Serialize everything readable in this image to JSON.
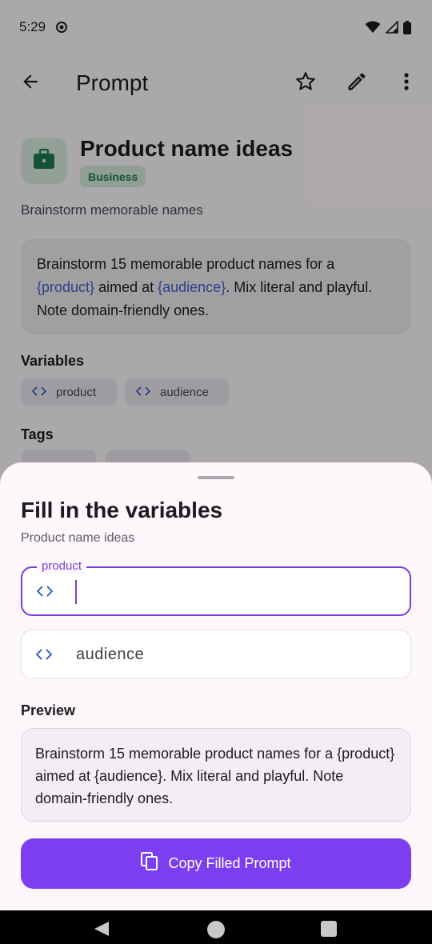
{
  "status_bar": {
    "time": "5:29",
    "icons": [
      "data-saver-icon",
      "wifi-icon",
      "signal-icon",
      "battery-icon"
    ]
  },
  "app_bar": {
    "title": "Prompt",
    "icons": [
      "back-arrow-icon",
      "star-outline-icon",
      "edit-pencil-icon",
      "more-vert-icon"
    ]
  },
  "prompt": {
    "title": "Product name ideas",
    "category": "Business",
    "category_icon": "briefcase-icon",
    "description": "Brainstorm memorable names",
    "template_parts": [
      {
        "text": "Brainstorm 15 memorable product names for a ",
        "var": false
      },
      {
        "text": "{product}",
        "var": true
      },
      {
        "text": " aimed at ",
        "var": false
      },
      {
        "text": "{audience}",
        "var": true
      },
      {
        "text": ". Mix literal and playful. Note domain-friendly ones.",
        "var": false
      }
    ]
  },
  "sections": {
    "variables": "Variables",
    "tags": "Tags"
  },
  "variable_chips": [
    "product",
    "audience"
  ],
  "sheet": {
    "title": "Fill in the variables",
    "subtitle": "Product name ideas",
    "fields": [
      {
        "label": "product",
        "value": "",
        "placeholder": "",
        "focused": true
      },
      {
        "label": "",
        "value": "",
        "placeholder": "audience",
        "focused": false
      }
    ],
    "preview_label": "Preview",
    "preview_text": "Brainstorm 15 memorable product names for a {product} aimed at {audience}. Mix literal and playful. Note domain-friendly ones.",
    "copy_button": "Copy Filled Prompt",
    "copy_icon": "copy-icon"
  },
  "nav": {
    "icons": [
      "nav-back-icon",
      "nav-home-icon",
      "nav-recents-icon"
    ]
  },
  "colors": {
    "accent": "#7b3fd8",
    "button": "#7b3ff0",
    "variable_token": "#3d63c9",
    "category_bg": "#d3ead9",
    "category_fg": "#1f7a4f",
    "scrim": "rgba(0,0,0,0.32)"
  }
}
